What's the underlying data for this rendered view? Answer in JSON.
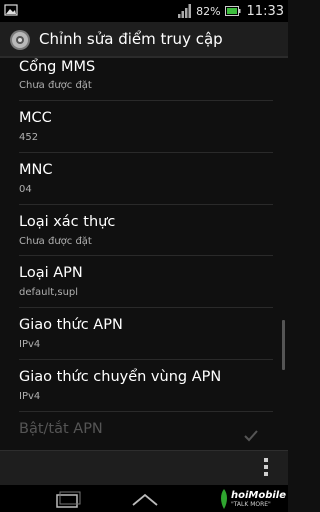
{
  "status_bar": {
    "battery_pct": "82%",
    "time": "11:33"
  },
  "action_bar": {
    "title": "Chỉnh sửa điểm truy cập",
    "icon": "settings-gear-icon"
  },
  "settings": [
    {
      "title": "Cổng MMS",
      "summary": "Chưa được đặt"
    },
    {
      "title": "MCC",
      "summary": "452"
    },
    {
      "title": "MNC",
      "summary": "04"
    },
    {
      "title": "Loại xác thực",
      "summary": "Chưa được đặt"
    },
    {
      "title": "Loại APN",
      "summary": "default,supl"
    },
    {
      "title": "Giao thức APN",
      "summary": "IPv4"
    },
    {
      "title": "Giao thức chuyển vùng APN",
      "summary": "IPv4"
    },
    {
      "title": "Bật/tắt APN",
      "summary": ""
    }
  ],
  "watermark": {
    "brand": "hoiMobile",
    "tagline": "\"TALK MORE\""
  }
}
